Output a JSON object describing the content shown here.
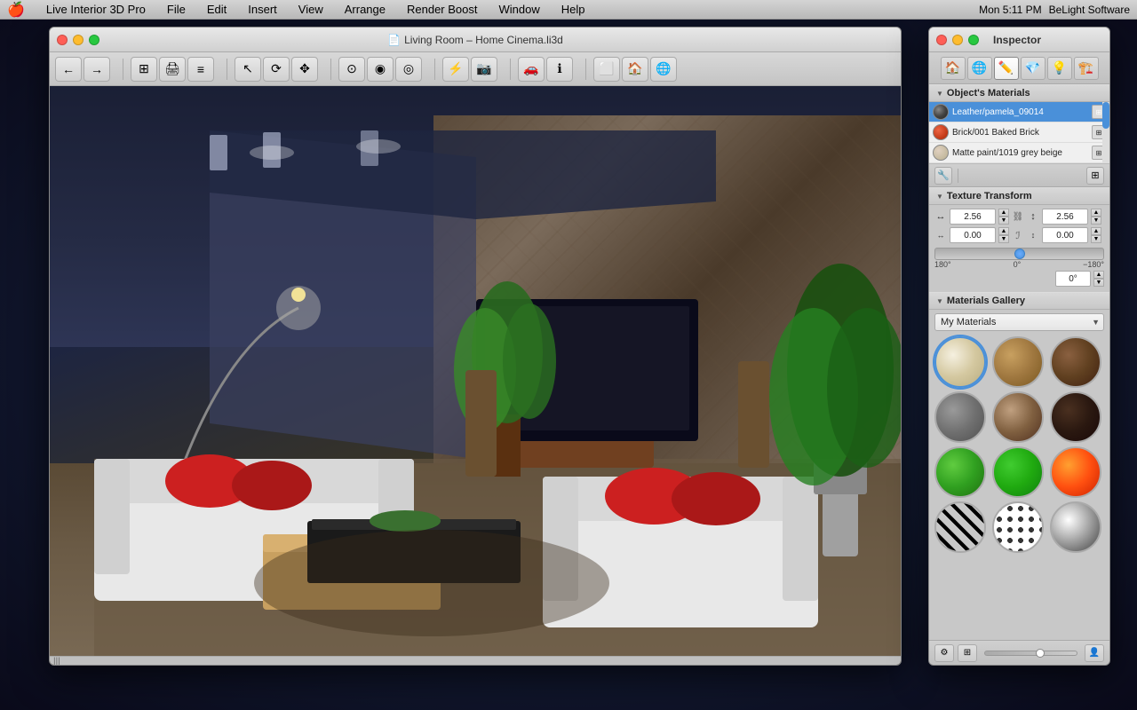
{
  "menubar": {
    "apple": "🍎",
    "items": [
      "Live Interior 3D Pro",
      "File",
      "Edit",
      "Insert",
      "View",
      "Arrange",
      "Render Boost",
      "Window",
      "Help"
    ],
    "right": {
      "time": "Mon 5:11 PM",
      "brand": "BeLight Software"
    }
  },
  "main_window": {
    "title": "Living Room – Home Cinema.li3d",
    "traffic_lights": {
      "red": "close",
      "yellow": "minimize",
      "green": "maximize"
    }
  },
  "toolbar": {
    "nav_back": "←",
    "nav_forward": "→",
    "tools": [
      "🏠",
      "📋",
      "≡",
      "↖",
      "⟳",
      "✥",
      "⊙",
      "◉",
      "◎",
      "⚡",
      "📷",
      "🎥",
      "ℹ",
      "⬜",
      "🏠",
      "🏠"
    ]
  },
  "inspector": {
    "title": "Inspector",
    "traffic_lights": {
      "red": "close",
      "yellow": "minimize",
      "green": "maximize"
    },
    "tabs": [
      {
        "icon": "🏠",
        "name": "object-tab"
      },
      {
        "icon": "🌐",
        "name": "material-tab"
      },
      {
        "icon": "✏️",
        "name": "edit-tab",
        "active": true
      },
      {
        "icon": "💎",
        "name": "texture-tab"
      },
      {
        "icon": "💡",
        "name": "light-tab"
      },
      {
        "icon": "🏗️",
        "name": "room-tab"
      }
    ],
    "objects_materials": {
      "label": "Object's Materials",
      "materials": [
        {
          "name": "Leather/pamela_09014",
          "swatch_color": "#555555",
          "selected": true
        },
        {
          "name": "Brick/001 Baked Brick",
          "swatch_color": "#cc4422",
          "selected": false
        },
        {
          "name": "Matte paint/1019 grey beige",
          "swatch_color": "#ccbbaa",
          "selected": false
        }
      ]
    },
    "texture_transform": {
      "label": "Texture Transform",
      "width_value": "2.56",
      "height_value": "2.56",
      "offset_x": "0.00",
      "offset_y": "0.00",
      "rotation_value": "0°",
      "rotation_min": "180°",
      "rotation_mid": "0°",
      "rotation_max": "−180°"
    },
    "materials_gallery": {
      "label": "Materials Gallery",
      "dropdown_value": "My Materials",
      "materials": [
        {
          "name": "cream-plaster",
          "class": "mb-cream"
        },
        {
          "name": "light-wood",
          "class": "mb-wood"
        },
        {
          "name": "dark-wood-brick",
          "class": "mb-darkwood"
        },
        {
          "name": "concrete",
          "class": "mb-concrete"
        },
        {
          "name": "brown-metal",
          "class": "mb-metal"
        },
        {
          "name": "dark-brown",
          "class": "mb-darkbrown"
        },
        {
          "name": "bright-green",
          "class": "mb-green"
        },
        {
          "name": "dark-green",
          "class": "mb-green2"
        },
        {
          "name": "fire",
          "class": "mb-fire"
        },
        {
          "name": "zebra",
          "class": "mb-zebra"
        },
        {
          "name": "spots",
          "class": "mb-spots"
        },
        {
          "name": "chrome",
          "class": "mb-chrome"
        }
      ]
    }
  }
}
